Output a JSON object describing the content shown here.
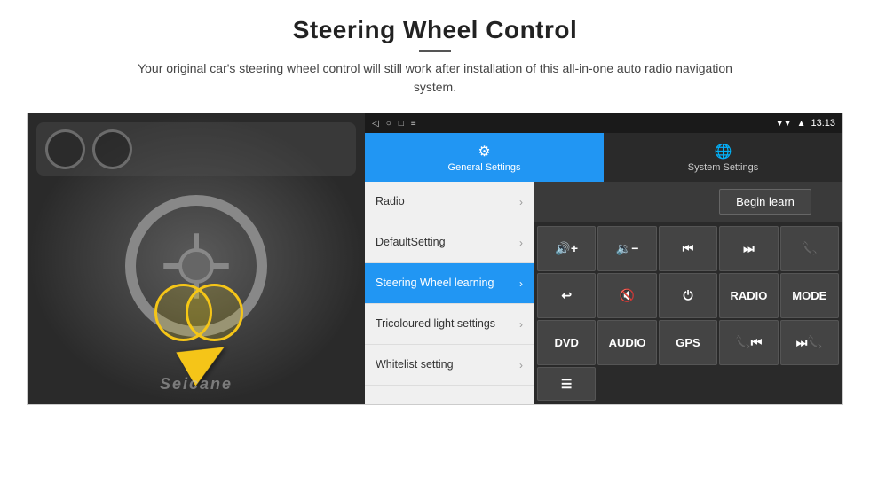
{
  "header": {
    "title": "Steering Wheel Control",
    "subtitle": "Your original car's steering wheel control will still work after installation of this all-in-one auto radio navigation system."
  },
  "status_bar": {
    "nav_back": "◁",
    "nav_home": "○",
    "nav_square": "□",
    "nav_menu": "≡",
    "signal_icon": "▼▼",
    "wifi_icon": "wifi",
    "time": "13:13"
  },
  "tabs": [
    {
      "id": "general",
      "label": "General Settings",
      "icon": "⚙",
      "active": true
    },
    {
      "id": "system",
      "label": "System Settings",
      "icon": "🌐",
      "active": false
    }
  ],
  "menu_items": [
    {
      "id": "radio",
      "label": "Radio",
      "active": false
    },
    {
      "id": "default",
      "label": "DefaultSetting",
      "active": false
    },
    {
      "id": "steering",
      "label": "Steering Wheel learning",
      "active": true
    },
    {
      "id": "tricolour",
      "label": "Tricoloured light settings",
      "active": false
    },
    {
      "id": "whitelist",
      "label": "Whitelist setting",
      "active": false
    }
  ],
  "controls": {
    "begin_learn_label": "Begin learn",
    "buttons_row1": [
      {
        "id": "vol_up",
        "label": "🔊+",
        "icon": true
      },
      {
        "id": "vol_down",
        "label": "🔉−",
        "icon": true
      },
      {
        "id": "prev_track",
        "label": "⏮",
        "icon": true
      },
      {
        "id": "next_track",
        "label": "⏭",
        "icon": true
      },
      {
        "id": "phone",
        "label": "📞",
        "icon": true
      }
    ],
    "buttons_row2": [
      {
        "id": "call_end",
        "label": "↩",
        "icon": true
      },
      {
        "id": "mute",
        "label": "🔇",
        "icon": true
      },
      {
        "id": "power",
        "label": "⏻",
        "icon": true
      },
      {
        "id": "radio_btn",
        "label": "RADIO",
        "icon": false
      },
      {
        "id": "mode_btn",
        "label": "MODE",
        "icon": false
      }
    ],
    "buttons_row3": [
      {
        "id": "dvd_btn",
        "label": "DVD",
        "icon": false
      },
      {
        "id": "audio_btn",
        "label": "AUDIO",
        "icon": false
      },
      {
        "id": "gps_btn",
        "label": "GPS",
        "icon": false
      },
      {
        "id": "tel_prev",
        "label": "📞⏮",
        "icon": true
      },
      {
        "id": "tel_next",
        "label": "⏭📞",
        "icon": true
      }
    ],
    "buttons_row4": [
      {
        "id": "list_btn",
        "label": "☰",
        "icon": true
      }
    ]
  },
  "watermark": "Seicane"
}
